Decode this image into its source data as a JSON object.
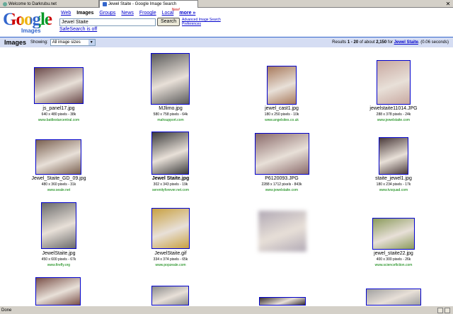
{
  "browser": {
    "tabs": [
      {
        "title": "Welcome to Darkrubu.net",
        "active": false
      },
      {
        "title": "Jewel Staite - Google Image Search",
        "active": true
      }
    ],
    "status": "Done"
  },
  "header": {
    "logo_text": "Google",
    "logo_sub": "Images",
    "nav": [
      "Web",
      "Images",
      "Groups",
      "News",
      "Froogle",
      "Local",
      "more »"
    ],
    "new_badge": "New!",
    "search_value": "Jewel Staite",
    "search_button": "Search",
    "advanced_link": "Advanced Image Search",
    "preferences_link": "Preferences",
    "safesearch": "SafeSearch is off"
  },
  "results_bar": {
    "title": "Images",
    "showing_label": "Showing:",
    "size_option": "All image sizes",
    "stats_prefix": "Results",
    "range": "1 - 20",
    "of_about": "of about",
    "total": "2,150",
    "for_label": "for",
    "query": "Jewel Staite",
    "time": "(0.06 seconds)"
  },
  "images": [
    {
      "filename": "js_panel17.jpg",
      "dims": "640 x 480 pixels - 38k",
      "domain": "www.battlestarcentral.com",
      "bold": false,
      "color": "#6b4a4a"
    },
    {
      "filename": "MJlimo.jpg",
      "dims": "580 x 758 pixels - 64k",
      "domain": "mahsupport.com",
      "bold": false,
      "color": "#5a5a5a"
    },
    {
      "filename": "jewel_cast1.jpg",
      "dims": "180 x 250 pixels - 10k",
      "domain": "www.angelsites.co.uk",
      "bold": false,
      "color": "#a87a5c"
    },
    {
      "filename": "jewelstaite11014.JPG",
      "dims": "288 x 378 pixels - 24k",
      "domain": "www.jewelstaite.com",
      "bold": false,
      "color": "#c8a8a0"
    },
    {
      "filename": "Jewel_Staite_GD_09.jpg",
      "dims": "480 x 360 pixels - 31k",
      "domain": "www.seale.net",
      "bold": false,
      "color": "#7a6050"
    },
    {
      "filename": "Jewel Staite.jpg",
      "dims": "302 x 343 pixels - 19k",
      "domain": "serenityforever.net.com",
      "bold": true,
      "color": "#3a3a3a"
    },
    {
      "filename": "P6120093.JPG",
      "dims": "2288 x 1712 pixels - 843k",
      "domain": "www.jewelstaite.com",
      "bold": false,
      "color": "#8a6a6a"
    },
    {
      "filename": "staite_jewel1.jpg",
      "dims": "180 x 234 pixels - 17k",
      "domain": "www.tvsquad.com",
      "bold": false,
      "color": "#4a3a3a"
    },
    {
      "filename": "JewelStaite.jpg",
      "dims": "450 x 600 pixels - 67k",
      "domain": "www.firefly.org",
      "bold": false,
      "color": "#6a6a6a"
    },
    {
      "filename": "JewelStaite.gif",
      "dims": "334 x 374 pixels - 65k",
      "domain": "www.popzeale.com",
      "bold": false,
      "color": "#c8a040"
    },
    {
      "filename": "",
      "dims": "",
      "domain": "",
      "bold": false,
      "color": "#b0a8b4"
    },
    {
      "filename": "jewel_staite22.jpg",
      "dims": "400 x 300 pixels - 26k",
      "domain": "www.sciencefiction.com",
      "bold": false,
      "color": "#8a9a5a"
    },
    {
      "filename": "",
      "dims": "",
      "domain": "",
      "bold": false,
      "color": "#7a5048"
    },
    {
      "filename": "",
      "dims": "",
      "domain": "",
      "bold": false,
      "color": "#8a8a8a"
    },
    {
      "filename": "",
      "dims": "",
      "domain": "",
      "bold": false,
      "color": "#3a3030"
    },
    {
      "filename": "",
      "dims": "",
      "domain": "",
      "bold": false,
      "color": "#a0a0a0"
    }
  ],
  "colors": {
    "link": "#0000cc",
    "results_bar": "#d5ddf3",
    "url_green": "#008000"
  }
}
